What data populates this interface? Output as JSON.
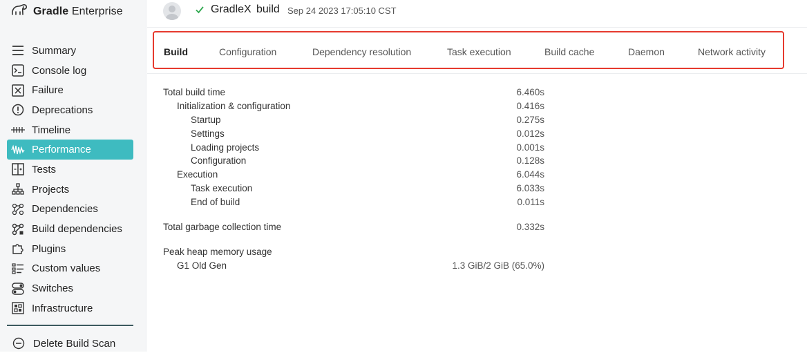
{
  "brand": {
    "bold": "Gradle",
    "light": " Enterprise"
  },
  "header": {
    "project": "GradleX",
    "task": "build",
    "timestamp": "Sep 24 2023 17:05:10 CST",
    "status_color": "#2fa84f"
  },
  "sidebar": {
    "items": [
      {
        "label": "Summary",
        "icon": "list-icon"
      },
      {
        "label": "Console log",
        "icon": "terminal-icon"
      },
      {
        "label": "Failure",
        "icon": "failure-icon"
      },
      {
        "label": "Deprecations",
        "icon": "warning-icon"
      },
      {
        "label": "Timeline",
        "icon": "timeline-icon"
      },
      {
        "label": "Performance",
        "icon": "performance-icon",
        "active": true
      },
      {
        "label": "Tests",
        "icon": "tests-icon"
      },
      {
        "label": "Projects",
        "icon": "projects-icon"
      },
      {
        "label": "Dependencies",
        "icon": "dependencies-icon"
      },
      {
        "label": "Build dependencies",
        "icon": "build-dependencies-icon"
      },
      {
        "label": "Plugins",
        "icon": "plugin-icon"
      },
      {
        "label": "Custom values",
        "icon": "custom-values-icon"
      },
      {
        "label": "Switches",
        "icon": "switches-icon"
      },
      {
        "label": "Infrastructure",
        "icon": "infrastructure-icon"
      }
    ],
    "delete_label": "Delete Build Scan",
    "accent": "#3ebbc0"
  },
  "tabs": [
    {
      "label": "Build",
      "active": true
    },
    {
      "label": "Configuration"
    },
    {
      "label": "Dependency resolution"
    },
    {
      "label": "Task execution"
    },
    {
      "label": "Build cache"
    },
    {
      "label": "Daemon"
    },
    {
      "label": "Network activity"
    }
  ],
  "build": {
    "total": {
      "label": "Total build time",
      "value": "6.460s"
    },
    "init": {
      "label": "Initialization & configuration",
      "value": "0.416s"
    },
    "init_items": [
      {
        "label": "Startup",
        "value": "0.275s"
      },
      {
        "label": "Settings",
        "value": "0.012s"
      },
      {
        "label": "Loading projects",
        "value": "0.001s"
      },
      {
        "label": "Configuration",
        "value": "0.128s"
      }
    ],
    "execution": {
      "label": "Execution",
      "value": "6.044s"
    },
    "execution_items": [
      {
        "label": "Task execution",
        "value": "6.033s"
      },
      {
        "label": "End of build",
        "value": "0.011s"
      }
    ],
    "gc": {
      "label": "Total garbage collection time",
      "value": "0.332s"
    },
    "heap": {
      "label": "Peak heap memory usage"
    },
    "heap_items": [
      {
        "label": "G1 Old Gen",
        "value": "1.3 GiB/2 GiB (65.0%)"
      }
    ]
  }
}
